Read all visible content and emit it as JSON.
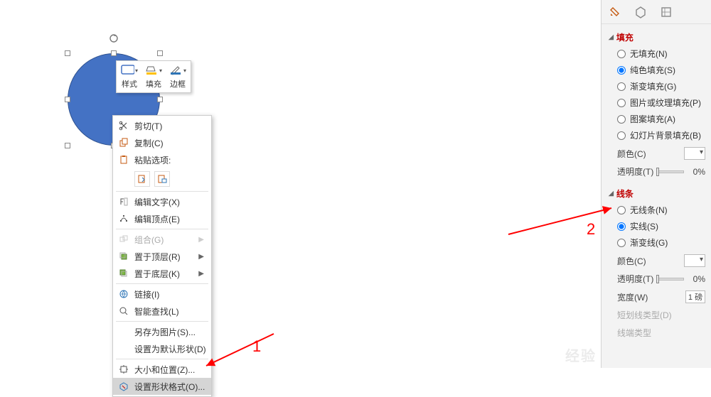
{
  "mini_toolbar": {
    "style": "样式",
    "fill": "填充",
    "border": "边框"
  },
  "context_menu": {
    "cut": "剪切(T)",
    "copy": "复制(C)",
    "paste_header": "粘贴选项:",
    "edit_text": "编辑文字(X)",
    "edit_points": "编辑顶点(E)",
    "group": "组合(G)",
    "bring_front": "置于顶层(R)",
    "send_back": "置于底层(K)",
    "link": "链接(I)",
    "smart_lookup": "智能查找(L)",
    "save_as_pic": "另存为图片(S)...",
    "set_default": "设置为默认形状(D)",
    "size_pos": "大小和位置(Z)...",
    "format_shape": "设置形状格式(O)..."
  },
  "format_pane": {
    "fill_section": "填充",
    "fill_options": {
      "none": "无填充(N)",
      "solid": "纯色填充(S)",
      "gradient": "渐变填充(G)",
      "picture": "图片或纹理填充(P)",
      "pattern": "图案填充(A)",
      "slide_bg": "幻灯片背景填充(B)"
    },
    "fill_selected": "solid",
    "color_label": "颜色(C)",
    "transparency_label": "透明度(T)",
    "transparency_value": "0%",
    "line_section": "线条",
    "line_options": {
      "none": "无线条(N)",
      "solid": "实线(S)",
      "gradient": "渐变线(G)"
    },
    "line_selected": "solid",
    "width_label": "宽度(W)",
    "width_value": "1 磅",
    "dash_label": "短划线类型(D)",
    "cap_label": "线端类型"
  },
  "annotations": {
    "one": "1",
    "two": "2"
  }
}
